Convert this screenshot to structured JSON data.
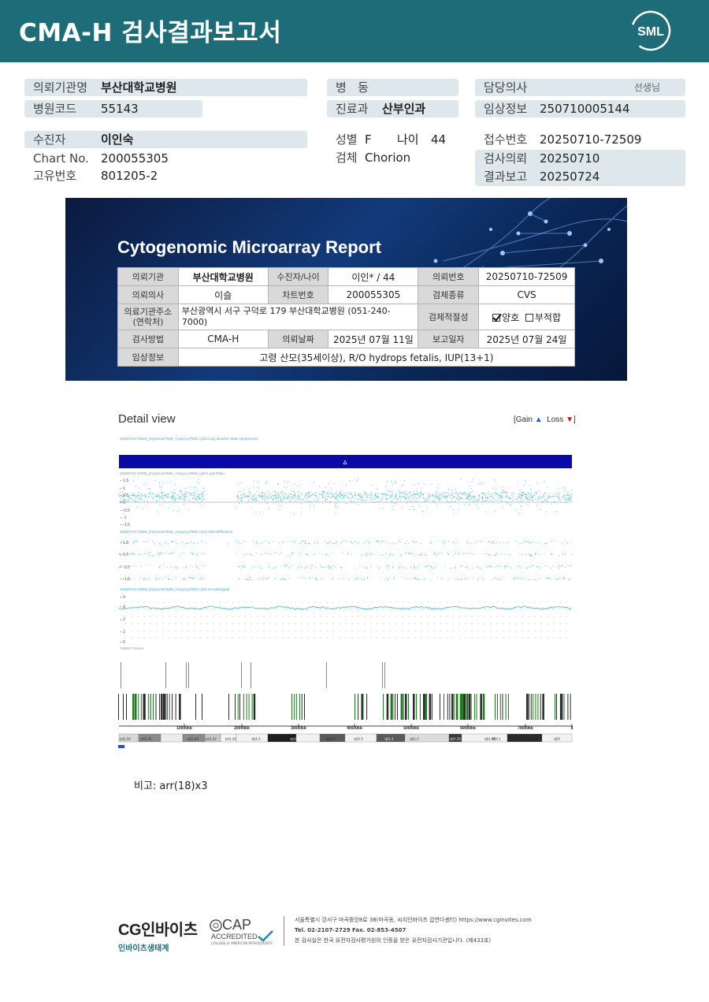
{
  "header": {
    "title": "CMA-H 검사결과보고서",
    "logo_text": "SML"
  },
  "patient_info": {
    "institution": {
      "label": "의뢰기관명",
      "value": "부산대학교병원"
    },
    "hospital_code": {
      "label": "병원코드",
      "value": "55143"
    },
    "patient": {
      "label": "수진자",
      "value": "이인숙"
    },
    "chart_no": {
      "label": "Chart No.",
      "value": "200055305"
    },
    "unique_no": {
      "label": "고유번호",
      "value": "801205-2"
    },
    "ward": {
      "label": "병   동",
      "value": ""
    },
    "department": {
      "label": "진료과",
      "value": "산부인과"
    },
    "sex": {
      "label": "성별",
      "value": "F"
    },
    "age": {
      "label": "나이",
      "value": "44"
    },
    "specimen": {
      "label": "검체",
      "value": "Chorion"
    },
    "doctor": {
      "label": "담당의사",
      "value": "",
      "suffix": "선생님"
    },
    "clinical": {
      "label": "임상정보",
      "value": "250710005144"
    },
    "receipt_no": {
      "label": "접수번호",
      "value": "20250710-72509"
    },
    "request_date": {
      "label": "검사의뢰",
      "value": "20250710"
    },
    "report_date": {
      "label": "결과보고",
      "value": "20250724"
    }
  },
  "report": {
    "title": "Cytogenomic Microarray Report",
    "rows": {
      "inst_label": "의뢰기관",
      "inst": "부산대학교병원",
      "pt_label": "수진자/나이",
      "pt": "이인* / 44",
      "reqno_label": "의뢰번호",
      "reqno": "20250710-72509",
      "doc_label": "의뢰의사",
      "doc": "이슬",
      "chart_label": "차트번호",
      "chart": "200055305",
      "spec_label": "검체종류",
      "spec": "CVS",
      "addr_label": "의료기관주소\n(연락처)",
      "addr": "부산광역시 서구 구덕로 179 부산대학교병원 (051-240-7000)",
      "suit_label": "검체적절성",
      "suit_ok": "양호",
      "suit_no": "부적합",
      "method_label": "검사방법",
      "method": "CMA-H",
      "reqdate_label": "의뢰날짜",
      "reqdate": "2025년 07월 11일",
      "repdate_label": "보고일자",
      "repdate": "2025년 07월 24일",
      "clin_label": "임상정보",
      "clin": "고령 산모(35세이상), R/O hydrops fetalis, IUP(13+1)"
    }
  },
  "detail": {
    "title": "Detail view",
    "legend_gain": "Gain",
    "legend_loss": "Loss",
    "tracks": [
      "20250710-72509_(CytoScan750K_Array).cy750K.cyhd Copy Number State (Segments)",
      "20250710-72509_(CytoScan750K_Array).cy750K.cyhd Log2 Ratio",
      "20250710-72509_(CytoScan750K_Array).cy750K.cyhd Allele Difference",
      "20250710-72509_(CytoScan750K_Array).cy750K.cyhd SmoothSignal",
      "OMIM® Genes"
    ],
    "gain_marker": "Δ",
    "log2_ticks": [
      "1.5",
      "1",
      "0.5",
      "0",
      "-0.5",
      "-1",
      "-1.5"
    ],
    "allele_ticks": [
      "1.5",
      "0.5",
      "-0.5",
      "-1.5"
    ],
    "smooth_ticks": [
      "4",
      "3",
      "2",
      "1",
      "0"
    ],
    "axis_labels": [
      "10000kb",
      "20000kb",
      "30000kb",
      "40000kb",
      "50000kb",
      "60000kb",
      "70000kb",
      "8"
    ],
    "bands": [
      "p11.32",
      "p11.31",
      "p11.23",
      "p11.22",
      "p11.21",
      "q11.2",
      "q12.1",
      "q12.2",
      "q12.3",
      "q21.1",
      "q21.2",
      "q21.32",
      "q21.33",
      "q22.1",
      "q22.3",
      "q23"
    ],
    "colors": {
      "gain_bar": "#0a0aa8",
      "points": "#33b8d8",
      "genes": "#1f7a1f"
    }
  },
  "remark": "비고: arr(18)x3",
  "footer": {
    "cg_name": "CG인바이츠",
    "cg_sub": "인바이츠생태계",
    "cap_text": "CAP",
    "cap_acc": "ACCREDITED",
    "cap_college": "COLLEGE of AMERICAN PATHOLOGISTS",
    "address": "서울특별시 강서구 마곡중앙8로 38(마곡동, 씨지인바이츠 압연다센터)  https://www.cginvites.com",
    "contact": "Tel. 02-2107-2729   Fax. 02-853-4507",
    "note": "본 검사실은 한국 유전자검사평가원의 인증을 받은 유전자검사기관입니다. (제433호)"
  }
}
